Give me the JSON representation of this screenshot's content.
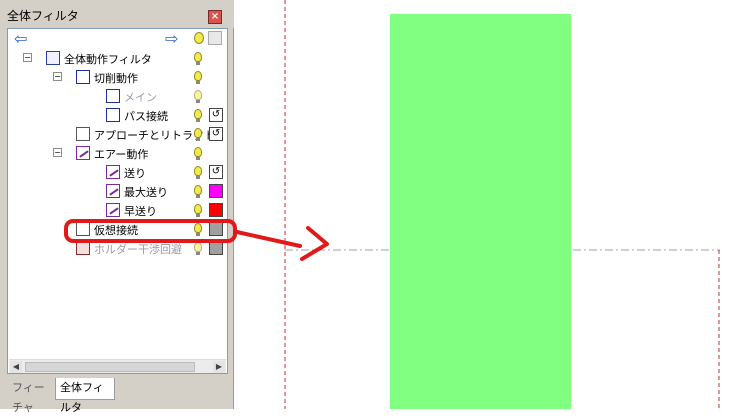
{
  "panel": {
    "title": "全体フィルタ",
    "close": "×",
    "nav": {
      "back": "⇦",
      "forward": "⇨"
    },
    "items": [
      {
        "label": "全体動作フィルタ",
        "indent": 0,
        "expander": "−",
        "icon": "folder-icon",
        "swatch": null,
        "dim": false
      },
      {
        "label": "切削動作",
        "indent": 1,
        "expander": "−",
        "icon": "box-icon",
        "swatch": null,
        "dim": false
      },
      {
        "label": "メイン",
        "indent": 2,
        "expander": null,
        "icon": "box-icon",
        "swatch": null,
        "dim": true
      },
      {
        "label": "パス接続",
        "indent": 2,
        "expander": null,
        "icon": "box-icon",
        "swatch": "reset",
        "dim": false
      },
      {
        "label": "アプローチとリトラクト",
        "indent": 1,
        "expander": null,
        "icon": "arrow-icon",
        "swatch": "reset",
        "dim": false
      },
      {
        "label": "エアー動作",
        "indent": 1,
        "expander": "−",
        "icon": "pen-icon",
        "swatch": null,
        "dim": false
      },
      {
        "label": "送り",
        "indent": 2,
        "expander": null,
        "icon": "pen-icon",
        "swatch": "reset",
        "dim": false
      },
      {
        "label": "最大送り",
        "indent": 2,
        "expander": null,
        "icon": "pen-icon",
        "swatch": "#ff00ff",
        "dim": false
      },
      {
        "label": "早送り",
        "indent": 2,
        "expander": null,
        "icon": "pen-icon",
        "swatch": "#ff0000",
        "dim": false
      },
      {
        "label": "仮想接続",
        "indent": 1,
        "expander": null,
        "icon": "arrow-icon",
        "swatch": "#a0a0a0",
        "dim": false
      },
      {
        "label": "ホルダー干渉回避",
        "indent": 1,
        "expander": null,
        "icon": "hole-icon",
        "swatch": "#a0a0a0",
        "dim": true
      }
    ],
    "tabs": [
      {
        "label": "フィーチャ",
        "active": false
      },
      {
        "label": "全体フィルタ",
        "active": true
      }
    ]
  },
  "colors": {
    "green_block": "#80ff80",
    "annotation_red": "#e01a1a",
    "dash_red": "#c03030",
    "dash_gray": "#a0a0a0"
  }
}
